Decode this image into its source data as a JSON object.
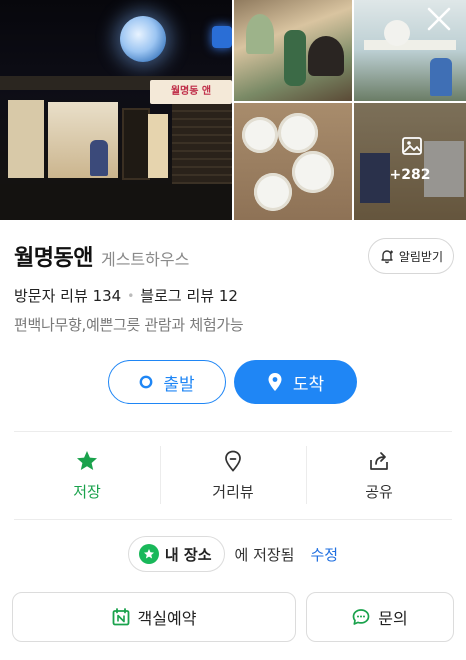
{
  "gallery": {
    "more_count": "+282",
    "shop_sign_text": "월명동 앤"
  },
  "place": {
    "name": "월명동앤",
    "category": "게스트하우스",
    "alarm_label": "알림받기",
    "visitor_reviews_label": "방문자 리뷰",
    "visitor_reviews_count": "134",
    "blog_reviews_label": "블로그 리뷰",
    "blog_reviews_count": "12",
    "description": "편백나무향,예쁜그릇 관람과 체험가능"
  },
  "route": {
    "start_label": "출발",
    "arrive_label": "도착"
  },
  "actions": {
    "save_label": "저장",
    "distance_label": "거리뷰",
    "share_label": "공유"
  },
  "saved": {
    "my_place_label": "내 장소",
    "saved_suffix": "에 저장됨",
    "edit_label": "수정"
  },
  "bottom": {
    "book_label": "객실예약",
    "inquiry_label": "문의"
  },
  "colors": {
    "accent_blue": "#1f86f5",
    "save_green": "#1aa24c",
    "my_place_green": "#19b85a",
    "edit_blue": "#1f6fe0"
  },
  "icons": {
    "alarm": "bell-plus-icon",
    "start": "circle-dot-icon",
    "arrive": "location-pin-icon",
    "save": "star-icon",
    "distance": "map-pin-outline-icon",
    "share": "share-icon",
    "book": "calendar-n-icon",
    "inquiry": "chat-bubble-icon",
    "close": "close-icon",
    "more_photos": "image-icon"
  }
}
